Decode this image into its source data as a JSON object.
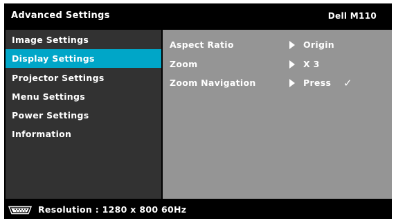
{
  "header": {
    "title": "Advanced Settings",
    "model": "Dell  M110"
  },
  "menu": {
    "items": [
      {
        "label": "Image Settings",
        "active": false
      },
      {
        "label": "Display Settings",
        "active": true
      },
      {
        "label": "Projector Settings",
        "active": false
      },
      {
        "label": "Menu Settings",
        "active": false
      },
      {
        "label": "Power Settings",
        "active": false
      },
      {
        "label": "Information",
        "active": false
      }
    ]
  },
  "settings": {
    "rows": [
      {
        "label": "Aspect Ratio",
        "value": "Origin"
      },
      {
        "label": "Zoom",
        "value": "X 3"
      },
      {
        "label": "Zoom Navigation",
        "value": "Press",
        "checkmark": "✓"
      }
    ]
  },
  "status": {
    "icon": "video-input-icon",
    "text": "Resolution : 1280 x 800 60Hz"
  },
  "colors": {
    "osd_background": "#000000",
    "menu_background": "#323232",
    "menu_highlight": "#00a6c8",
    "content_background": "#959595",
    "text": "#ffffff"
  }
}
